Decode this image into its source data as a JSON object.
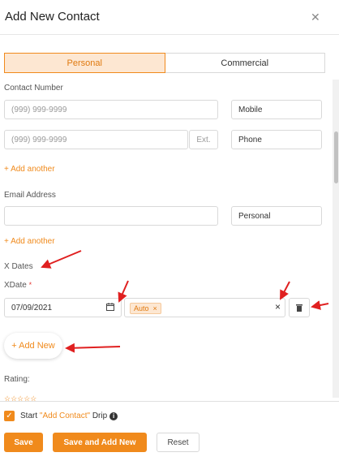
{
  "header": {
    "title": "Add New Contact",
    "close_icon": "close-icon"
  },
  "tabs": [
    {
      "label": "Personal",
      "active": true
    },
    {
      "label": "Commercial",
      "active": false
    }
  ],
  "contact_number": {
    "label": "Contact Number",
    "rows": [
      {
        "placeholder": "(999) 999-9999",
        "type": "Mobile"
      },
      {
        "placeholder": "(999) 999-9999",
        "ext_placeholder": "Ext.",
        "type": "Phone"
      }
    ],
    "add_another": "+ Add another"
  },
  "email": {
    "label": "Email Address",
    "value": "",
    "type": "Personal",
    "add_another": "+ Add another"
  },
  "xdates": {
    "section_label": "X Dates",
    "field_label": "XDate",
    "required_mark": "*",
    "date_value": "07/09/2021",
    "calendar_icon": "calendar-icon",
    "tag": "Auto",
    "tag_remove": "×",
    "clear": "×",
    "trash_icon": "trash-icon",
    "add_new": "+ Add New"
  },
  "rating": {
    "label": "Rating:",
    "stars": "☆☆☆☆☆",
    "value": 0
  },
  "footer": {
    "drip_prefix": "Start ",
    "drip_highlight": "\"Add Contact\"",
    "drip_suffix": " Drip",
    "drip_checked": true,
    "save": "Save",
    "save_add_new": "Save and Add New",
    "reset": "Reset"
  },
  "colors": {
    "accent": "#f08a1c",
    "annotation_arrow": "#e02020"
  }
}
